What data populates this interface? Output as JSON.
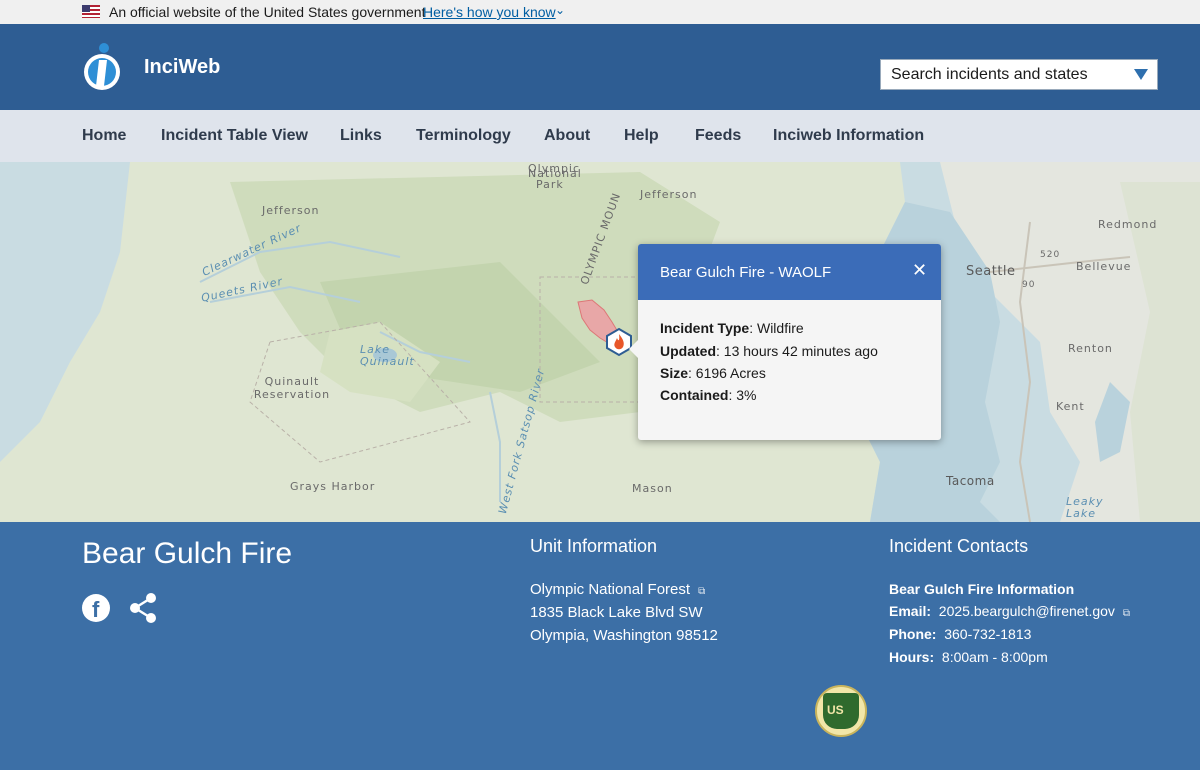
{
  "gov_banner": {
    "text": "An official website of the United States government",
    "link": "Here's how you know"
  },
  "header": {
    "brand": "IinciWeb",
    "search_placeholder": "Search incidents and states"
  },
  "nav": {
    "items": [
      "Home",
      "Incident Table View",
      "Links",
      "Terminology",
      "About",
      "Help",
      "Feeds",
      "Inciweb Information"
    ]
  },
  "map": {
    "labels": {
      "jefferson_w": "Jefferson",
      "jefferson_e": "Jefferson",
      "olympic": "Olympic",
      "national": "National",
      "park": "Park",
      "olympic_mtn": "OLYMPIC MOUN",
      "clearwater": "Clearwater River",
      "queets": "Queets River",
      "lake_quinault": "Lake Quinault",
      "quinault_res": "Quinault Reservation",
      "grays_harbor": "Grays Harbor",
      "mason": "Mason",
      "west_fork": "West Fork Satsop River",
      "seattle": "Seattle",
      "redmond": "Redmond",
      "bellevue": "Bellevue",
      "renton": "Renton",
      "kent": "Kent",
      "tacoma": "Tacoma",
      "leaky_lake": "Leaky Lake",
      "hw520": "520",
      "hw90": "90"
    },
    "popup": {
      "title": "Bear Gulch Fire - WAOLF",
      "close": "✕",
      "type_label": "Incident Type",
      "type_value": ": Wildfire",
      "updated_label": "Updated",
      "updated_value": ": 13 hours 42 minutes ago",
      "size_label": "Size",
      "size_value": ": 6196 Acres",
      "contained_label": "Contained",
      "contained_value": ": 3%"
    }
  },
  "footer": {
    "fire_title": "Bear Gulch Fire",
    "unit": {
      "title": "Unit Information",
      "name": "Olympic National Forest",
      "address": "1835 Black Lake Blvd SW",
      "city": "Olympia,  Washington  98512"
    },
    "contacts": {
      "title": "Incident Contacts",
      "name": "Bear Gulch Fire Information",
      "email_label": "Email:",
      "email_value": "2025.beargulch@firenet.gov",
      "phone_label": "Phone:",
      "phone_value": "360-732-1813",
      "hours_label": "Hours:",
      "hours_value": "8:00am - 8:00pm"
    },
    "seal_text": "US"
  },
  "colors": {
    "header_bg": "#2e5d93",
    "nav_bg": "#dfe4ec",
    "footer_bg": "#3c6fa6",
    "popup_head": "#3b6cb8"
  }
}
